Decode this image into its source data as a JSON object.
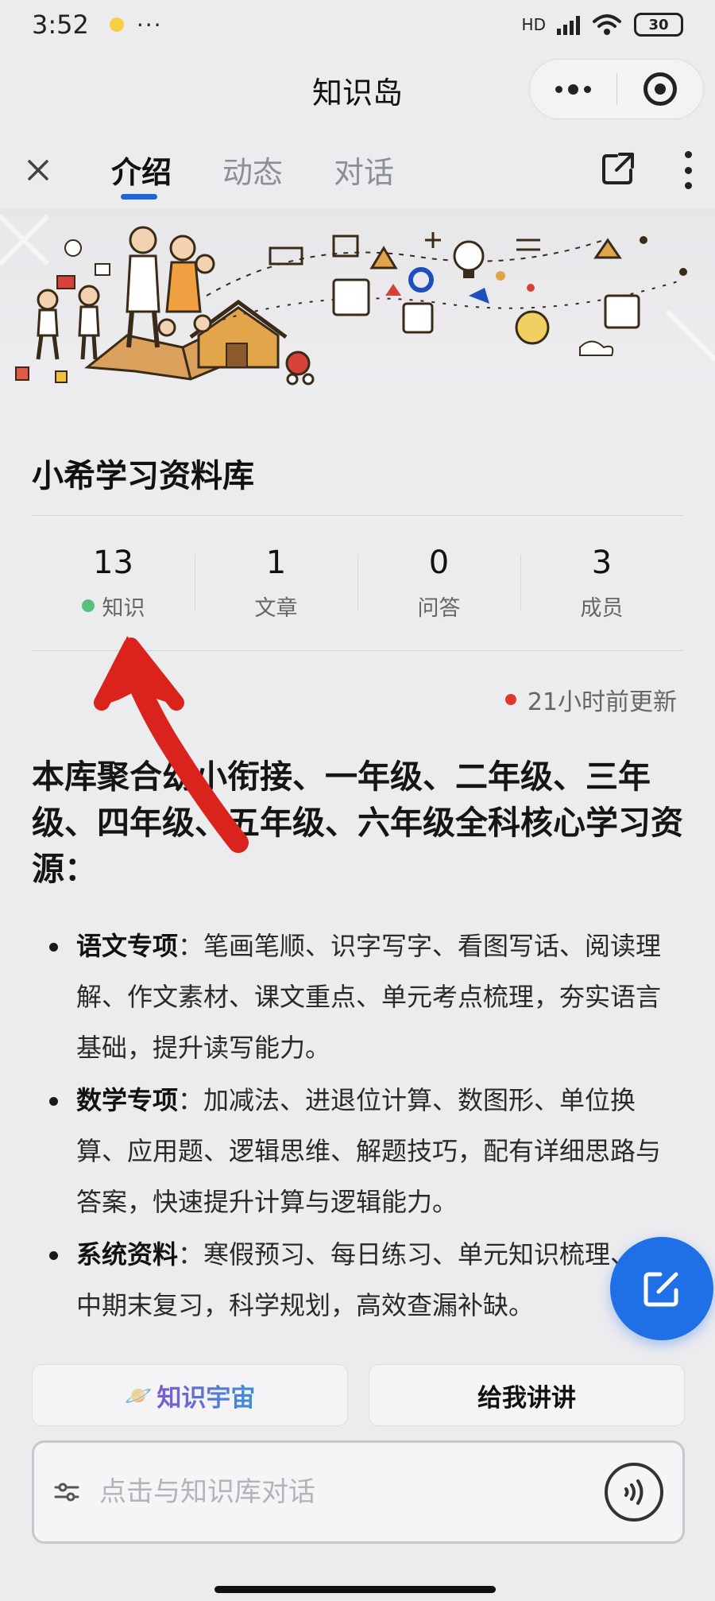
{
  "status_bar": {
    "time": "3:52",
    "battery": "30",
    "network_label": "HD"
  },
  "title_bar": {
    "title": "知识岛"
  },
  "tabs": [
    {
      "label": "介绍",
      "active": true
    },
    {
      "label": "动态",
      "active": false
    },
    {
      "label": "对话",
      "active": false
    }
  ],
  "library": {
    "title": "小希学习资料库",
    "stats": [
      {
        "value": "13",
        "label": "知识"
      },
      {
        "value": "1",
        "label": "文章"
      },
      {
        "value": "0",
        "label": "问答"
      },
      {
        "value": "3",
        "label": "成员"
      }
    ],
    "updated": "21小时前更新"
  },
  "content": {
    "headline": "本库聚合幼小衔接、一年级、二年级、三年级、四年级、五年级、六年级全科核心学习资源：",
    "bullets": [
      {
        "title": "语文专项",
        "text": "：笔画笔顺、识字写字、看图写话、阅读理解、作文素材、课文重点、单元考点梳理，夯实语言基础，提升读写能力。"
      },
      {
        "title": "数学专项",
        "text": "：加减法、进退位计算、数图形、单位换算、应用题、逻辑思维、解题技巧，配有详细思路与答案，快速提升计算与逻辑能力。"
      },
      {
        "title": "系统资料",
        "text": "：寒假预习、每日练习、单元知识梳理、期中期末复习，科学规划，高效查漏补缺。"
      }
    ]
  },
  "actions": {
    "universe_icon": "🪐",
    "universe_label": "知识宇宙",
    "explain_label": "给我讲讲"
  },
  "chat": {
    "placeholder": "点击与知识库对话"
  },
  "colors": {
    "accent_blue": "#1f6fe6",
    "active_dot_green": "#58c27d",
    "update_dot_red": "#e0372f",
    "annotation_red": "#d9231c"
  }
}
